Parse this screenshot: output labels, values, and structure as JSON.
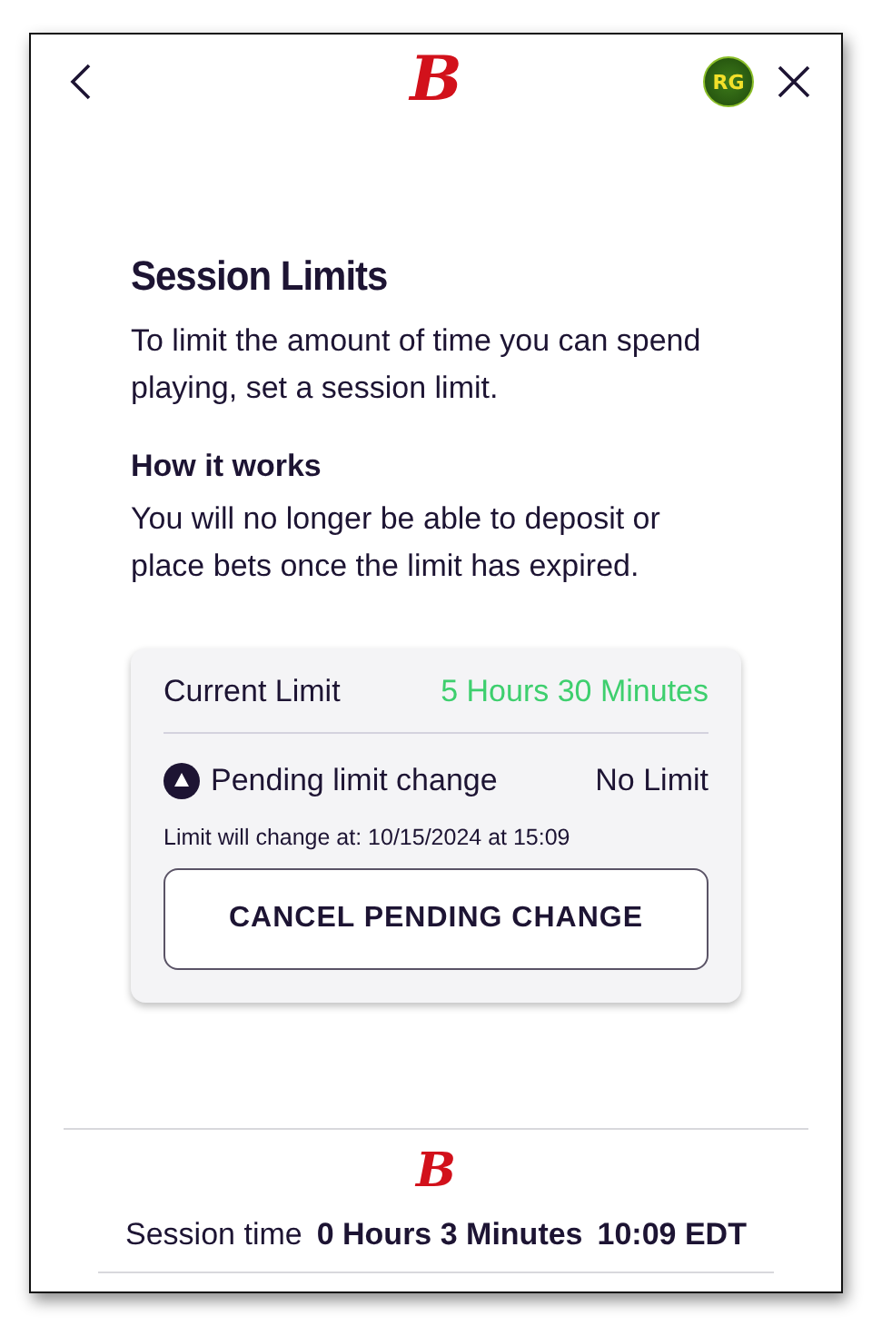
{
  "header": {
    "brand_mark": "B",
    "badge": "RG"
  },
  "title": "Session Limits",
  "intro": "To limit the amount of time you can spend playing, set a session limit.",
  "how_heading": "How it works",
  "how_text": "You will no longer be able to deposit or place bets once the limit has expired.",
  "card": {
    "current_label": "Current Limit",
    "current_value": "5 Hours 30 Minutes",
    "pending_label": "Pending limit change",
    "pending_value": "No Limit",
    "change_note": "Limit will change at: 10/15/2024 at 15:09",
    "button": "CANCEL PENDING CHANGE"
  },
  "footer": {
    "brand_mark": "B",
    "session_label": "Session time",
    "session_value": "0 Hours 3 Minutes",
    "clock": "10:09 EDT"
  }
}
